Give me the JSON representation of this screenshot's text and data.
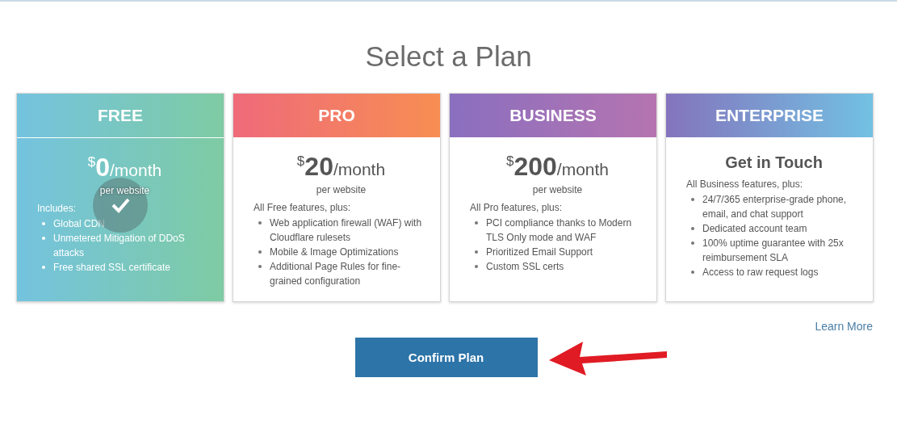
{
  "title": "Select a Plan",
  "plans": [
    {
      "name": "FREE",
      "selected": true,
      "kind": "price",
      "currency": "$",
      "amount": "0",
      "period": "/month",
      "note": "per website",
      "intro": "Includes:",
      "features": [
        "Global CDN",
        "Unmetered Mitigation of DDoS attacks",
        "Free shared SSL certificate"
      ]
    },
    {
      "name": "PRO",
      "selected": false,
      "kind": "price",
      "currency": "$",
      "amount": "20",
      "period": "/month",
      "note": "per website",
      "intro": "All Free features, plus:",
      "features": [
        "Web application firewall (WAF) with Cloudflare rulesets",
        "Mobile & Image Optimizations",
        "Additional Page Rules for fine-grained configuration"
      ]
    },
    {
      "name": "BUSINESS",
      "selected": false,
      "kind": "price",
      "currency": "$",
      "amount": "200",
      "period": "/month",
      "note": "per website",
      "intro": "All Pro features, plus:",
      "features": [
        "PCI compliance thanks to Modern TLS Only mode and WAF",
        "Prioritized Email Support",
        "Custom SSL certs"
      ]
    },
    {
      "name": "ENTERPRISE",
      "selected": false,
      "kind": "contact",
      "contact": "Get in Touch",
      "intro": "All Business features, plus:",
      "features": [
        "24/7/365 enterprise-grade phone, email, and chat support",
        "Dedicated account team",
        "100% uptime guarantee with 25x reimbursement SLA",
        "Access to raw request logs"
      ]
    }
  ],
  "learn_more": "Learn More",
  "confirm": "Confirm Plan"
}
